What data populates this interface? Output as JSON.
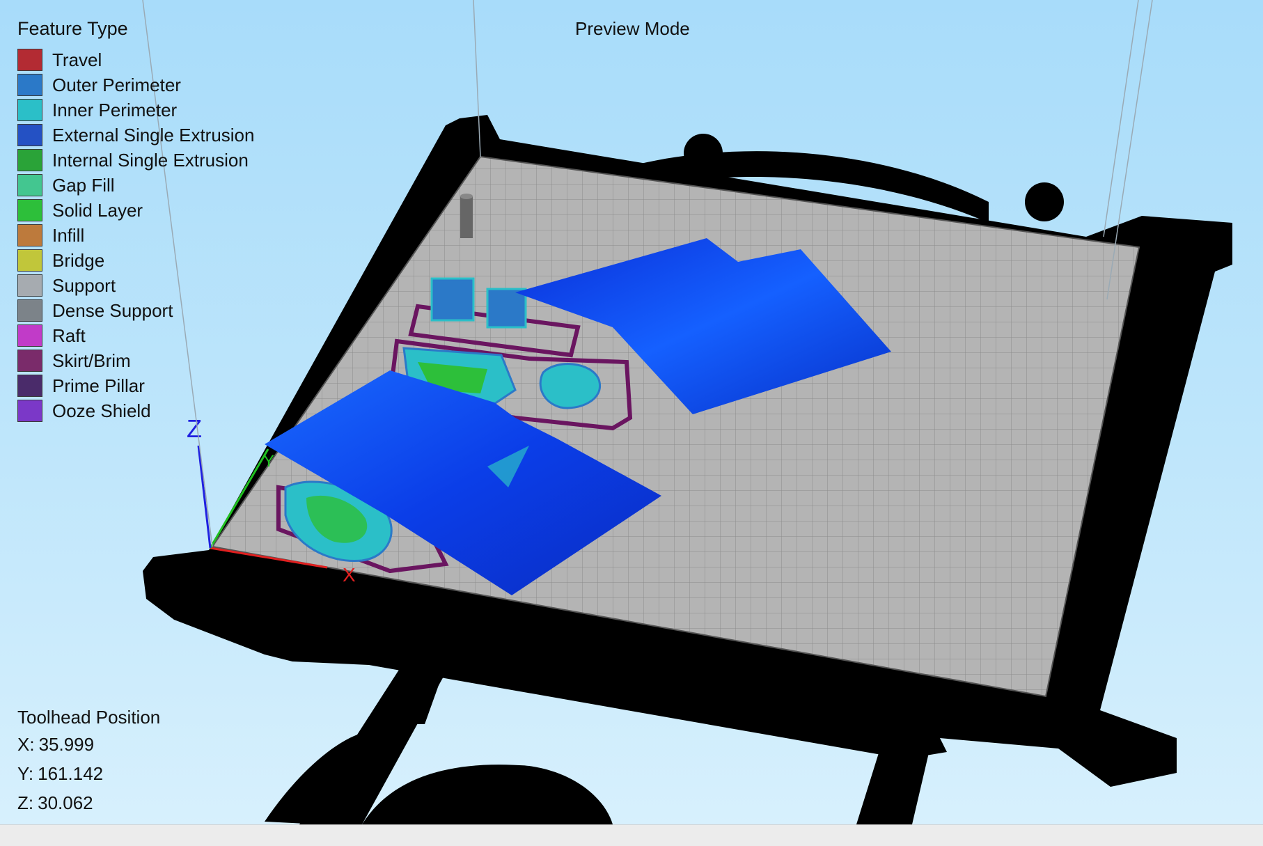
{
  "legend": {
    "title": "Feature Type",
    "items": [
      {
        "label": "Travel",
        "color": "#b32b33"
      },
      {
        "label": "Outer Perimeter",
        "color": "#2b79c8"
      },
      {
        "label": "Inner Perimeter",
        "color": "#2bbfc8"
      },
      {
        "label": "External Single Extrusion",
        "color": "#2451c4"
      },
      {
        "label": "Internal Single Extrusion",
        "color": "#2aa338"
      },
      {
        "label": "Gap Fill",
        "color": "#43c690"
      },
      {
        "label": "Solid Layer",
        "color": "#2dbf3a"
      },
      {
        "label": "Infill",
        "color": "#bd7a3c"
      },
      {
        "label": "Bridge",
        "color": "#c1c63a"
      },
      {
        "label": "Support",
        "color": "#a6abb0"
      },
      {
        "label": "Dense Support",
        "color": "#7c8389"
      },
      {
        "label": "Raft",
        "color": "#c13bc8"
      },
      {
        "label": "Skirt/Brim",
        "color": "#7a2b6a"
      },
      {
        "label": "Prime Pillar",
        "color": "#4a2b6a"
      },
      {
        "label": "Ooze Shield",
        "color": "#7b38c8"
      }
    ]
  },
  "viewport": {
    "mode_title": "Preview Mode",
    "colors": {
      "background": "#b3e0fb",
      "bed_plate": "#b4b4b4",
      "bed_grid": "#8c8c8c",
      "printer_frame": "#000000",
      "preview_layer": "#0a4fff",
      "x_axis": "#e02020",
      "y_axis": "#20c020",
      "z_axis": "#2020e0"
    },
    "axis_labels": {
      "x": "X",
      "y": "Y",
      "z": "Z"
    }
  },
  "toolhead": {
    "title": "Toolhead Position",
    "x_label": "X:",
    "x_value": "35.999",
    "y_label": "Y:",
    "y_value": "161.142",
    "z_label": "Z:",
    "z_value": "30.062"
  }
}
